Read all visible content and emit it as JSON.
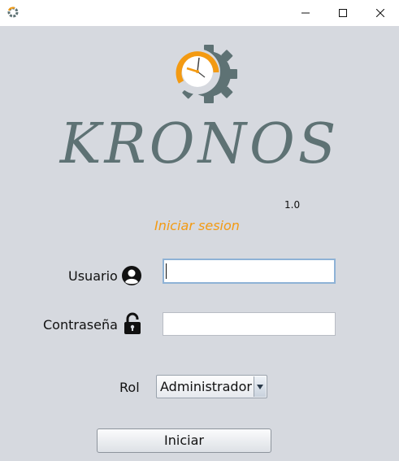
{
  "window": {
    "minimize_icon": "minimize-icon",
    "maximize_icon": "maximize-icon",
    "close_icon": "close-icon"
  },
  "brand": {
    "name": "KRONOS",
    "version": "1.0",
    "logo": "clock-gear-logo",
    "accent_color": "#f39a12",
    "gear_color": "#5e7274"
  },
  "form": {
    "title": "Iniciar sesion",
    "user_label": "Usuario",
    "user_value": "",
    "password_label": "Contraseña",
    "password_value": "",
    "role_label": "Rol",
    "role_selected": "Administrador",
    "submit_label": "Iniciar"
  }
}
